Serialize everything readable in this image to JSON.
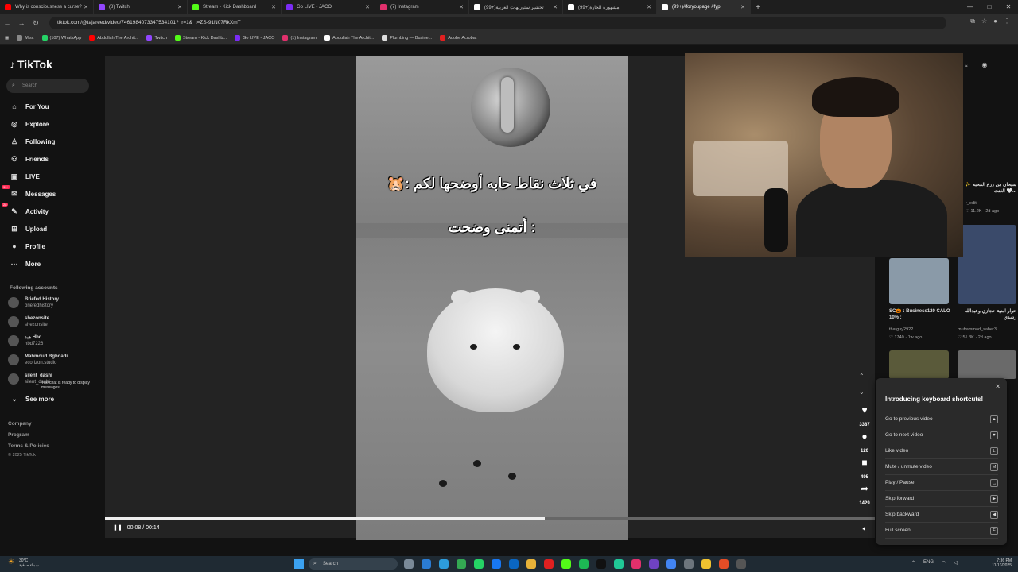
{
  "browser": {
    "tabs": [
      {
        "title": "Why is consciousness a curse?",
        "color": "#ff0000"
      },
      {
        "title": "(8) Twitch",
        "color": "#9146ff"
      },
      {
        "title": "Stream - Kick Dashboard",
        "color": "#53fc18"
      },
      {
        "title": "Go LIVE - JACO",
        "color": "#7b2cf5"
      },
      {
        "title": "(7) Instagram",
        "color": "#e1306c"
      },
      {
        "title": "(99+)تحشير ستوريهات العربية",
        "color": "#ffffff"
      },
      {
        "title": "(99+)مشهورة الحارة",
        "color": "#ffffff"
      },
      {
        "title": "(99+)#foryoupage #fyp",
        "color": "#ffffff"
      }
    ],
    "new_tab": "+",
    "url": "tiktok.com/@tajareed/video/7461984073347534101?_r=1&_t=ZS-91N07RkXmT",
    "bookmarks": [
      {
        "label": "Misc",
        "color": "#888888"
      },
      {
        "label": "(107) WhatsApp",
        "color": "#25d366"
      },
      {
        "label": "Abdullah The Archit...",
        "color": "#ff0000"
      },
      {
        "label": "Twitch",
        "color": "#9146ff"
      },
      {
        "label": "Stream - Kick Dashb...",
        "color": "#53fc18"
      },
      {
        "label": "Go LIVE - JACO",
        "color": "#7b2cf5"
      },
      {
        "label": "(1) Instagram",
        "color": "#e1306c"
      },
      {
        "label": "Abdullah The Archit...",
        "color": "#ffffff"
      },
      {
        "label": "Plumbing — Busine...",
        "color": "#dddddd"
      },
      {
        "label": "Adobe Acrobat",
        "color": "#e02020"
      }
    ]
  },
  "tiktok": {
    "logo": "TikTok",
    "search_placeholder": "Search",
    "nav": [
      {
        "label": "For You",
        "icon": "home-icon",
        "glyph": "⌂"
      },
      {
        "label": "Explore",
        "icon": "compass-icon",
        "glyph": "◎"
      },
      {
        "label": "Following",
        "icon": "user-follow-icon",
        "glyph": "♙"
      },
      {
        "label": "Friends",
        "icon": "friends-icon",
        "glyph": "⚇"
      },
      {
        "label": "LIVE",
        "icon": "live-icon",
        "glyph": "▣"
      },
      {
        "label": "Messages",
        "icon": "message-icon",
        "glyph": "✉",
        "badge": "99+"
      },
      {
        "label": "Activity",
        "icon": "activity-icon",
        "glyph": "✎",
        "badge": "28"
      },
      {
        "label": "Upload",
        "icon": "upload-icon",
        "glyph": "⊞"
      },
      {
        "label": "Profile",
        "icon": "profile-icon",
        "glyph": "●"
      },
      {
        "label": "More",
        "icon": "more-icon",
        "glyph": "⋯"
      }
    ],
    "following_title": "Following accounts",
    "accounts": [
      {
        "name": "Briefed History",
        "handle": "briefedhistory"
      },
      {
        "name": "shezonsite",
        "handle": "shezonsite"
      },
      {
        "name": "هبد Hbd",
        "handle": "hbd7226"
      },
      {
        "name": "Mahmoud Bghdadi",
        "handle": "ecorizon.studio"
      },
      {
        "name": "silent_dashi",
        "handle": "silent_dashi"
      }
    ],
    "see_more": "See more",
    "chat_message": "The chat is ready to display messages.",
    "footer": [
      "Company",
      "Program",
      "Terms & Policies",
      "© 2025 TikTok"
    ],
    "video": {
      "caption_line1": "🐹: في ثلاث نقاط حابه أوضحها لكم",
      "caption_line2": "أتمنى وضحت :",
      "time": "00:08 / 00:14",
      "progress": 0.571,
      "username": "tajareed"
    },
    "actions": [
      {
        "icon": "heart-icon",
        "glyph": "♥",
        "count": "3387"
      },
      {
        "icon": "comment-icon",
        "glyph": "●",
        "count": "120"
      },
      {
        "icon": "bookmark-icon",
        "glyph": "■",
        "count": "495"
      },
      {
        "icon": "share-icon",
        "glyph": "➦",
        "count": "1429"
      }
    ],
    "side_videos": [
      {
        "caption": "سبحان من زرع المحبة ✨🤍 الغنت...",
        "author": "r_edit",
        "likes": "11.2K",
        "age": "2d ago"
      },
      {
        "caption": "SC🎃 : Business120 CALO 10% :",
        "author": "thatguy2922",
        "likes": "1740",
        "age": "1w ago"
      },
      {
        "caption": "حوار امنية حجازي وعبدالله رشدي",
        "author": "muhammad_saber3",
        "likes": "51.3K",
        "age": "2d ago"
      }
    ],
    "shortcuts": {
      "title": "Introducing keyboard shortcuts!",
      "items": [
        {
          "label": "Go to previous video",
          "key": "▲"
        },
        {
          "label": "Go to next video",
          "key": "▼"
        },
        {
          "label": "Like video",
          "key": "L"
        },
        {
          "label": "Mute / unmute video",
          "key": "M"
        },
        {
          "label": "Play / Pause",
          "key": "␣"
        },
        {
          "label": "Skip forward",
          "key": "▶"
        },
        {
          "label": "Skip backward",
          "key": "◀"
        },
        {
          "label": "Full screen",
          "key": "F"
        }
      ]
    }
  },
  "taskbar": {
    "weather_temp": "30°C",
    "weather_desc": "سماء صافية",
    "search": "Search",
    "lang": "ENG",
    "time": "7:36 PM",
    "date": "11/13/2025"
  }
}
